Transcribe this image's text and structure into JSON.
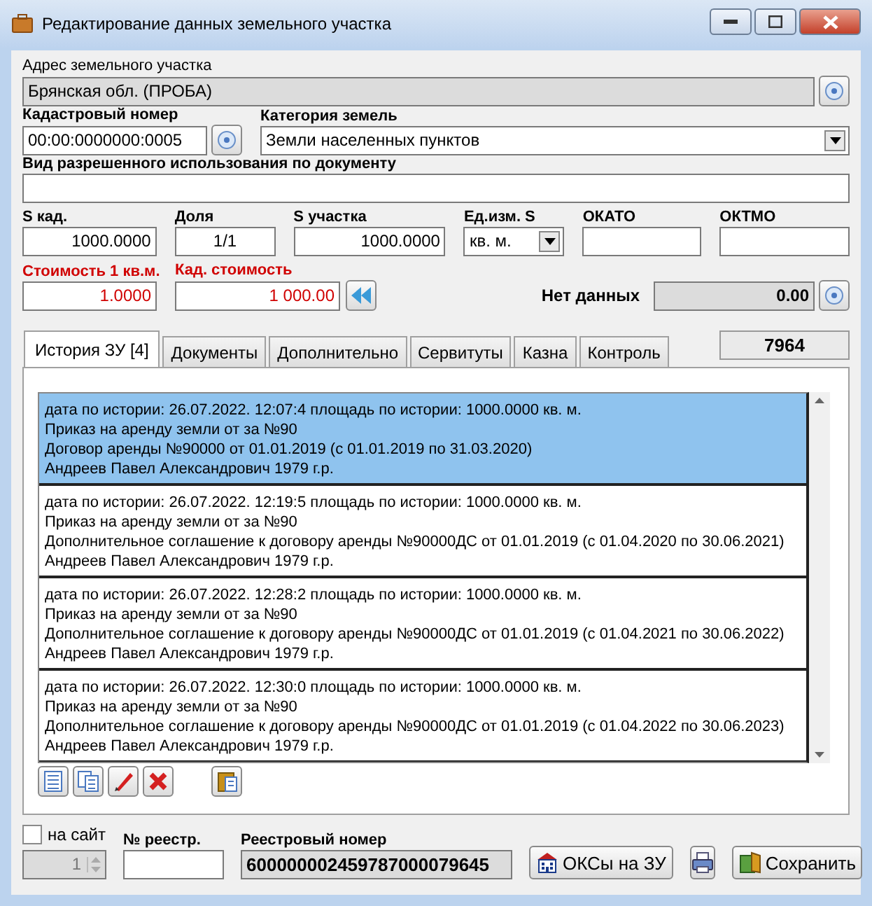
{
  "window": {
    "title": "Редактирование данных земельного участка"
  },
  "address": {
    "label": "Адрес земельного участка",
    "value": "Брянская обл. (ПРОБА)"
  },
  "cadastral_number": {
    "label": "Кадастровый номер",
    "value": "00:00:0000000:0005"
  },
  "land_category": {
    "label": "Категория земель",
    "value": "Земли населенных пунктов"
  },
  "permitted_use": {
    "label": "Вид разрешенного использования по документу"
  },
  "fields": [
    {
      "kind": "text",
      "label": "S кад.",
      "value": "1000.0000"
    },
    {
      "kind": "text",
      "label": "Доля",
      "value": "1/1"
    },
    {
      "kind": "text",
      "label": "S участка",
      "value": "1000.0000"
    },
    {
      "kind": "select",
      "label": "Ед.изм. S",
      "value": "кв. м."
    },
    {
      "kind": "text",
      "label": "ОКАТО"
    },
    {
      "kind": "text",
      "label": "ОКТМО"
    }
  ],
  "cost_per_m2": {
    "label": "Стоимость 1 кв.м.",
    "value": "1.0000"
  },
  "cadastral_cost": {
    "label": "Кад. стоимость",
    "value": "1 000.00"
  },
  "no_data": {
    "label": "Нет данных",
    "value": "0.00"
  },
  "tabs": [
    {
      "label": "История ЗУ [4]",
      "selected": true
    },
    {
      "label": "Документы",
      "selected": false
    },
    {
      "label": "Дополнительно",
      "selected": false
    },
    {
      "label": "Сервитуты",
      "selected": false
    },
    {
      "label": "Казна",
      "selected": false
    },
    {
      "label": "Контроль",
      "selected": false
    }
  ],
  "record_id": "7964",
  "history": [
    {
      "selected": true,
      "lines": [
        "дата по истории: 26.07.2022. 12:07:4 площадь по истории: 1000.0000 кв. м.",
        "Приказ на аренду земли от  за №90",
        "Договор аренды №90000 от 01.01.2019 (с 01.01.2019 по 31.03.2020)",
        "Андреев Павел Александрович 1979 г.р."
      ]
    },
    {
      "selected": false,
      "lines": [
        "дата по истории: 26.07.2022. 12:19:5 площадь по истории: 1000.0000 кв. м.",
        "Приказ на аренду земли от  за №90",
        "Дополнительное соглашение к договору аренды №90000ДС от 01.01.2019 (с 01.04.2020 по 30.06.2021)",
        "Андреев Павел Александрович 1979 г.р."
      ]
    },
    {
      "selected": false,
      "lines": [
        "дата по истории: 26.07.2022. 12:28:2 площадь по истории: 1000.0000 кв. м.",
        "Приказ на аренду земли от  за №90",
        "Дополнительное соглашение к договору аренды №90000ДС от 01.01.2019 (с 01.04.2021 по 30.06.2022)",
        "Андреев Павел Александрович 1979 г.р."
      ]
    },
    {
      "selected": false,
      "lines": [
        "дата по истории: 26.07.2022. 12:30:0 площадь по истории: 1000.0000 кв. м.",
        "Приказ на аренду земли от  за №90",
        "Дополнительное соглашение к договору аренды №90000ДС от 01.01.2019 (с 01.04.2022 по 30.06.2023)",
        "Андреев Павел Александрович 1979 г.р."
      ]
    }
  ],
  "on_site": {
    "label": "на сайт",
    "checked": false
  },
  "counter": {
    "value": "1"
  },
  "registry_no": {
    "label": "№ реестр."
  },
  "registry_number": {
    "label": "Реестровый номер",
    "value": "600000002459787000079645"
  },
  "buttons": {
    "oks": "ОКСы на ЗУ",
    "save": "Сохранить"
  }
}
